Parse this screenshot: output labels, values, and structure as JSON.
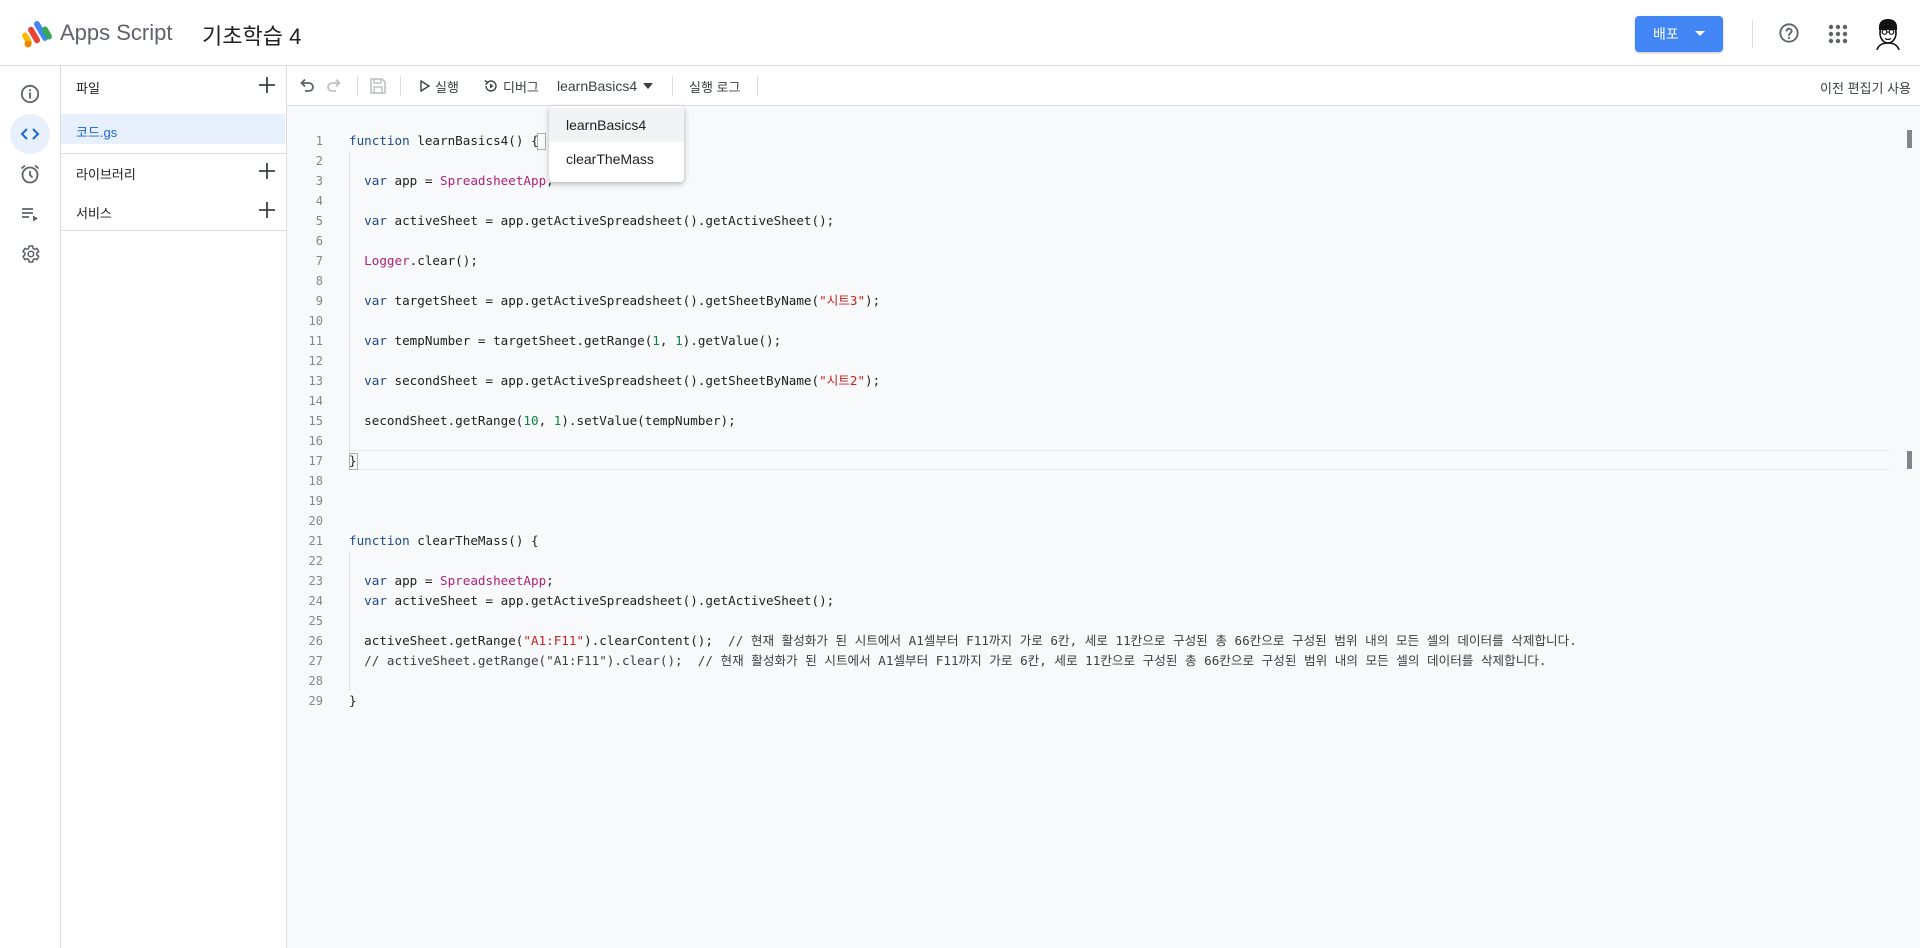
{
  "header": {
    "app_name": "Apps Script",
    "project_title": "기초학습 4",
    "deploy_label": "배포",
    "brand_color": "#4285f4"
  },
  "rail": {
    "items": [
      {
        "name": "overview",
        "icon": "info-icon"
      },
      {
        "name": "editor",
        "icon": "code-icon",
        "active": true
      },
      {
        "name": "triggers",
        "icon": "alarm-icon"
      },
      {
        "name": "executions",
        "icon": "executions-icon"
      },
      {
        "name": "settings",
        "icon": "gear-icon"
      }
    ]
  },
  "files_panel": {
    "files_label": "파일",
    "file_name": "코드.gs",
    "libraries_label": "라이브러리",
    "services_label": "서비스"
  },
  "toolbar": {
    "run_label": "실행",
    "debug_label": "디버그",
    "function_selected": "learnBasics4",
    "log_label": "실행 로그",
    "old_editor_label": "이전 편집기 사용"
  },
  "dropdown": {
    "options": [
      "learnBasics4",
      "clearTheMass"
    ]
  },
  "editor": {
    "line_numbers": [
      "1",
      "2",
      "3",
      "4",
      "5",
      "6",
      "7",
      "8",
      "9",
      "10",
      "11",
      "12",
      "13",
      "14",
      "15",
      "16",
      "17",
      "18",
      "19",
      "20",
      "21",
      "22",
      "23",
      "24",
      "25",
      "26",
      "27",
      "28",
      "29"
    ],
    "code_lines": [
      "function learnBasics4() {",
      "",
      "  var app = SpreadsheetApp;",
      "",
      "  var activeSheet = app.getActiveSpreadsheet().getActiveSheet();",
      "",
      "  Logger.clear();",
      "",
      "  var targetSheet = app.getActiveSpreadsheet().getSheetByName(\"시트3\");",
      "",
      "  var tempNumber = targetSheet.getRange(1, 1).getValue();",
      "",
      "  var secondSheet = app.getActiveSpreadsheet().getSheetByName(\"시트2\");",
      "",
      "  secondSheet.getRange(10, 1).setValue(tempNumber);",
      "",
      "}",
      "",
      "",
      "",
      "function clearTheMass() {",
      "",
      "  var app = SpreadsheetApp;",
      "  var activeSheet = app.getActiveSpreadsheet().getActiveSheet();",
      "",
      "  activeSheet.getRange(\"A1:F11\").clearContent();  // 현재 활성화가 된 시트에서 A1셀부터 F11까지 가로 6칸, 세로 11칸으로 구성된 총 66칸으로 구성된 범위 내의 모든 셀의 데이터를 삭제합니다.",
      "  // activeSheet.getRange(\"A1:F11\").clear();  // 현재 활성화가 된 시트에서 A1셀부터 F11까지 가로 6칸, 세로 11칸으로 구성된 총 66칸으로 구성된 범위 내의 모든 셀의 데이터를 삭제합니다.",
      "",
      "}"
    ]
  }
}
